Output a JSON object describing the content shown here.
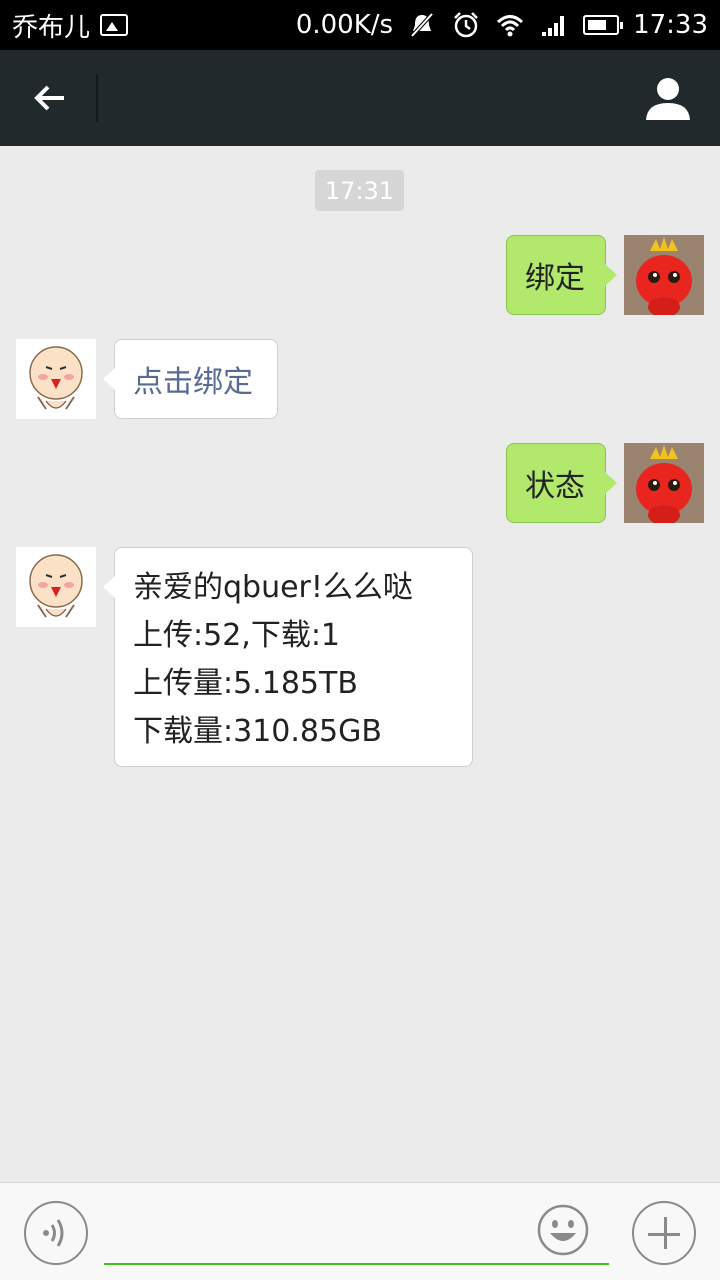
{
  "status_bar": {
    "carrier": "乔布儿",
    "speed": "0.00K/s",
    "time": "17:33"
  },
  "title_bar": {
    "title": "",
    "back_icon": "back-arrow-icon",
    "contact_icon": "person-icon"
  },
  "chat": {
    "timestamp": "17:31",
    "messages": [
      {
        "direction": "outgoing",
        "text": "绑定"
      },
      {
        "direction": "incoming",
        "text": "点击绑定"
      },
      {
        "direction": "outgoing",
        "text": "状态"
      },
      {
        "direction": "incoming",
        "lines": [
          "亲爱的qbuer!么么哒",
          "上传:52,下载:1",
          "上传量:5.185TB",
          "下载量:310.85GB"
        ]
      }
    ]
  },
  "input_bar": {
    "placeholder": "",
    "voice_icon": "voice-icon",
    "emoji_icon": "emoji-icon",
    "plus_icon": "plus-icon"
  },
  "colors": {
    "outgoing_bubble": "#b2e86b",
    "incoming_link": "#576b95",
    "accent_line": "#45c01a",
    "title_bar": "#22292c"
  }
}
